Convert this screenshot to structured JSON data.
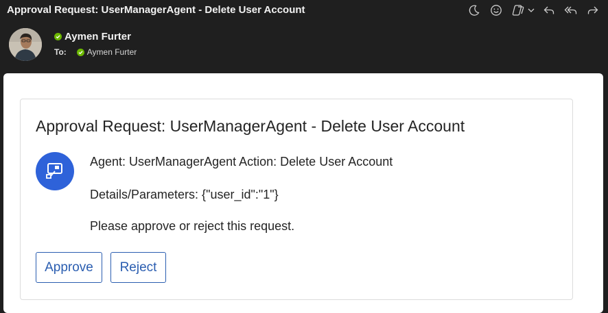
{
  "email": {
    "subject": "Approval Request: UserManagerAgent - Delete User Account",
    "sender": {
      "name": "Aymen Furter",
      "presence_color": "#6bb700"
    },
    "to": {
      "label": "To:",
      "recipient": "Aymen Furter"
    }
  },
  "toolbar": {
    "icons": [
      "moon-icon",
      "emoji-icon",
      "copilot-icon",
      "chevron-down-icon",
      "reply-icon",
      "reply-all-icon",
      "forward-icon"
    ]
  },
  "card": {
    "title": "Approval Request: UserManagerAgent - Delete User Account",
    "icon": "power-automate-icon",
    "icon_color": "#2e62d9",
    "line1": "Agent: UserManagerAgent Action: Delete User Account",
    "line2": "Details/Parameters: {\"user_id\":\"1\"}",
    "line3": "Please approve or reject this request.",
    "approve_label": "Approve",
    "reject_label": "Reject",
    "accent_color": "#2a5db0"
  }
}
